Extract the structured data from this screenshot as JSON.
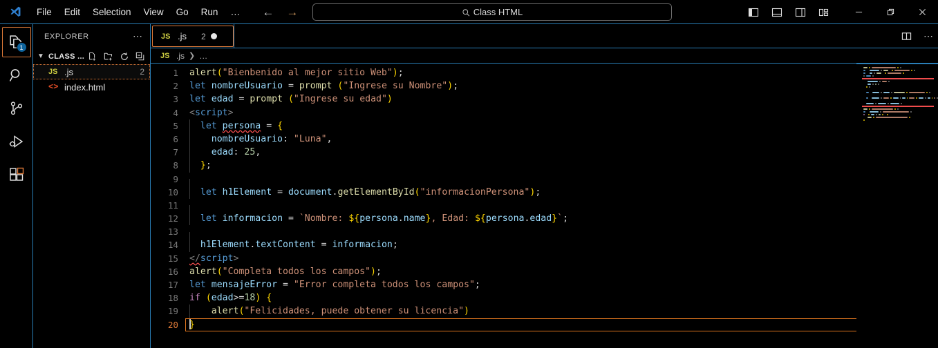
{
  "titlebar": {
    "logo_icon": "vscode-logo-icon",
    "menu": [
      {
        "label": "File"
      },
      {
        "label": "Edit"
      },
      {
        "label": "Selection"
      },
      {
        "label": "View"
      },
      {
        "label": "Go"
      },
      {
        "label": "Run"
      },
      {
        "label": "…"
      }
    ],
    "nav": {
      "back_icon": "arrow-left-icon",
      "forward_icon": "arrow-right-icon"
    },
    "command_center": {
      "icon": "search-icon",
      "text": "Class HTML",
      "placeholder": "Search"
    },
    "layout_actions": [
      {
        "name": "toggle-primary-sidebar",
        "icon": "layout-sidebar-left-icon"
      },
      {
        "name": "toggle-panel",
        "icon": "layout-panel-icon"
      },
      {
        "name": "toggle-secondary-sidebar",
        "icon": "layout-sidebar-right-icon"
      },
      {
        "name": "customize-layout",
        "icon": "layout-customize-icon"
      }
    ],
    "window_controls": [
      {
        "name": "minimize-button",
        "glyph": "─"
      },
      {
        "name": "restore-button",
        "glyph": "❐"
      },
      {
        "name": "close-button",
        "glyph": "✕"
      }
    ]
  },
  "activitybar": {
    "items": [
      {
        "name": "explorer",
        "icon": "files-icon",
        "badge": "1",
        "active": true
      },
      {
        "name": "search",
        "icon": "search-icon",
        "badge": "",
        "active": false
      },
      {
        "name": "source-control",
        "icon": "source-control-icon",
        "badge": "",
        "active": false
      },
      {
        "name": "run-and-debug",
        "icon": "run-debug-icon",
        "badge": "",
        "active": false
      },
      {
        "name": "extensions",
        "icon": "extensions-icon",
        "badge": "",
        "active": false
      }
    ]
  },
  "sidebar": {
    "title": "EXPLORER",
    "more_actions_icon": "ellipsis-icon",
    "folder": {
      "label": "CLASS ...",
      "expanded": true,
      "chevron_icon": "chevron-down-icon",
      "actions": [
        {
          "name": "new-file-button",
          "icon": "new-file-icon"
        },
        {
          "name": "new-folder-button",
          "icon": "new-folder-icon"
        },
        {
          "name": "refresh-explorer-button",
          "icon": "refresh-icon"
        },
        {
          "name": "collapse-folders-button",
          "icon": "collapse-all-icon"
        }
      ]
    },
    "files": [
      {
        "icon": "js-file-icon",
        "icon_label": "JS",
        "name": ".js",
        "count": "2",
        "selected": true
      },
      {
        "icon": "html-file-icon",
        "icon_label": "<>",
        "name": "index.html",
        "count": "",
        "selected": false
      }
    ]
  },
  "editor": {
    "tabs": [
      {
        "icon_label": "JS",
        "label": ".js",
        "count": "2",
        "dirty": true,
        "active": true
      }
    ],
    "tab_actions": [
      {
        "name": "split-editor-right-button",
        "icon": "split-editor-icon"
      },
      {
        "name": "more-editor-actions-button",
        "icon": "ellipsis-icon"
      }
    ],
    "breadcrumbs": [
      {
        "icon_label": "JS",
        "label": ".js"
      },
      {
        "label": "…"
      }
    ],
    "active_line": 20,
    "cursor": {
      "line": 20,
      "column": 1
    },
    "lines": [
      {
        "n": 1,
        "indent": 0,
        "tokens": [
          {
            "t": "alert",
            "c": "c-fn"
          },
          {
            "t": "(",
            "c": "c-paren"
          },
          {
            "t": "\"Bienbenido al mejor sitio Web\"",
            "c": "c-str"
          },
          {
            "t": ")",
            "c": "c-paren"
          },
          {
            "t": ";",
            "c": "c-punc"
          }
        ]
      },
      {
        "n": 2,
        "indent": 0,
        "tokens": [
          {
            "t": "let",
            "c": "c-let"
          },
          {
            "t": " ",
            "c": "c-punc"
          },
          {
            "t": "nombreUsuario",
            "c": "c-var"
          },
          {
            "t": " = ",
            "c": "c-op"
          },
          {
            "t": "prompt",
            "c": "c-fn"
          },
          {
            "t": " ",
            "c": "c-punc"
          },
          {
            "t": "(",
            "c": "c-paren"
          },
          {
            "t": "\"Ingrese su Nombre\"",
            "c": "c-str"
          },
          {
            "t": ")",
            "c": "c-paren"
          },
          {
            "t": ";",
            "c": "c-punc"
          }
        ]
      },
      {
        "n": 3,
        "indent": 0,
        "tokens": [
          {
            "t": "let",
            "c": "c-let"
          },
          {
            "t": " ",
            "c": "c-punc"
          },
          {
            "t": "edad",
            "c": "c-var"
          },
          {
            "t": " = ",
            "c": "c-op"
          },
          {
            "t": "prompt",
            "c": "c-fn"
          },
          {
            "t": " ",
            "c": "c-punc"
          },
          {
            "t": "(",
            "c": "c-paren"
          },
          {
            "t": "\"Ingrese su edad\"",
            "c": "c-str"
          },
          {
            "t": ")",
            "c": "c-paren"
          }
        ]
      },
      {
        "n": 4,
        "indent": 0,
        "tokens": [
          {
            "t": "<",
            "c": "c-tagb"
          },
          {
            "t": "script",
            "c": "c-tag"
          },
          {
            "t": ">",
            "c": "c-tagb"
          }
        ]
      },
      {
        "n": 5,
        "indent": 1,
        "tokens": [
          {
            "t": "  ",
            "c": "c-punc"
          },
          {
            "t": "let",
            "c": "c-let"
          },
          {
            "t": " ",
            "c": "c-punc"
          },
          {
            "t": "persona",
            "c": "c-var squiggly"
          },
          {
            "t": " = ",
            "c": "c-op"
          },
          {
            "t": "{",
            "c": "c-paren"
          }
        ]
      },
      {
        "n": 6,
        "indent": 1,
        "tokens": [
          {
            "t": "    ",
            "c": "c-punc"
          },
          {
            "t": "nombreUsuario",
            "c": "c-prop"
          },
          {
            "t": ": ",
            "c": "c-punc"
          },
          {
            "t": "\"Luna\"",
            "c": "c-str"
          },
          {
            "t": ",",
            "c": "c-punc"
          }
        ]
      },
      {
        "n": 7,
        "indent": 1,
        "tokens": [
          {
            "t": "    ",
            "c": "c-punc"
          },
          {
            "t": "edad",
            "c": "c-prop"
          },
          {
            "t": ": ",
            "c": "c-punc"
          },
          {
            "t": "25",
            "c": "c-num"
          },
          {
            "t": ",",
            "c": "c-punc"
          }
        ]
      },
      {
        "n": 8,
        "indent": 1,
        "tokens": [
          {
            "t": "  ",
            "c": "c-punc"
          },
          {
            "t": "}",
            "c": "c-paren"
          },
          {
            "t": ";",
            "c": "c-punc"
          }
        ]
      },
      {
        "n": 9,
        "indent": 1,
        "tokens": []
      },
      {
        "n": 10,
        "indent": 1,
        "tokens": [
          {
            "t": "  ",
            "c": "c-punc"
          },
          {
            "t": "let",
            "c": "c-let"
          },
          {
            "t": " ",
            "c": "c-punc"
          },
          {
            "t": "h1Element",
            "c": "c-var"
          },
          {
            "t": " = ",
            "c": "c-op"
          },
          {
            "t": "document",
            "c": "c-var"
          },
          {
            "t": ".",
            "c": "c-punc"
          },
          {
            "t": "getElementById",
            "c": "c-fn"
          },
          {
            "t": "(",
            "c": "c-paren"
          },
          {
            "t": "\"informacionPersona\"",
            "c": "c-str"
          },
          {
            "t": ")",
            "c": "c-paren"
          },
          {
            "t": ";",
            "c": "c-punc"
          }
        ]
      },
      {
        "n": 11,
        "indent": 1,
        "tokens": []
      },
      {
        "n": 12,
        "indent": 1,
        "tokens": [
          {
            "t": "  ",
            "c": "c-punc"
          },
          {
            "t": "let",
            "c": "c-let"
          },
          {
            "t": " ",
            "c": "c-punc"
          },
          {
            "t": "informacion",
            "c": "c-var"
          },
          {
            "t": " = ",
            "c": "c-op"
          },
          {
            "t": "`Nombre: ",
            "c": "c-tmpl"
          },
          {
            "t": "${",
            "c": "c-paren"
          },
          {
            "t": "persona",
            "c": "c-var"
          },
          {
            "t": ".",
            "c": "c-punc"
          },
          {
            "t": "name",
            "c": "c-prop"
          },
          {
            "t": "}",
            "c": "c-paren"
          },
          {
            "t": ", Edad: ",
            "c": "c-tmpl"
          },
          {
            "t": "${",
            "c": "c-paren"
          },
          {
            "t": "persona",
            "c": "c-var"
          },
          {
            "t": ".",
            "c": "c-punc"
          },
          {
            "t": "edad",
            "c": "c-prop"
          },
          {
            "t": "}",
            "c": "c-paren"
          },
          {
            "t": "`",
            "c": "c-tmpl"
          },
          {
            "t": ";",
            "c": "c-punc"
          }
        ]
      },
      {
        "n": 13,
        "indent": 1,
        "tokens": []
      },
      {
        "n": 14,
        "indent": 1,
        "tokens": [
          {
            "t": "  ",
            "c": "c-punc"
          },
          {
            "t": "h1Element",
            "c": "c-var"
          },
          {
            "t": ".",
            "c": "c-punc"
          },
          {
            "t": "textContent",
            "c": "c-prop"
          },
          {
            "t": " = ",
            "c": "c-op"
          },
          {
            "t": "informacion",
            "c": "c-var"
          },
          {
            "t": ";",
            "c": "c-punc"
          }
        ]
      },
      {
        "n": 15,
        "indent": 0,
        "tokens": [
          {
            "t": "</",
            "c": "c-tagb squiggly"
          },
          {
            "t": "script",
            "c": "c-tag"
          },
          {
            "t": ">",
            "c": "c-tagb"
          }
        ]
      },
      {
        "n": 16,
        "indent": 0,
        "tokens": [
          {
            "t": "alert",
            "c": "c-fn"
          },
          {
            "t": "(",
            "c": "c-paren"
          },
          {
            "t": "\"Completa todos los campos\"",
            "c": "c-str"
          },
          {
            "t": ")",
            "c": "c-paren"
          },
          {
            "t": ";",
            "c": "c-punc"
          }
        ]
      },
      {
        "n": 17,
        "indent": 0,
        "tokens": [
          {
            "t": "let",
            "c": "c-let"
          },
          {
            "t": " ",
            "c": "c-punc"
          },
          {
            "t": "mensajeError",
            "c": "c-var"
          },
          {
            "t": " = ",
            "c": "c-op"
          },
          {
            "t": "\"Error completa todos los campos\"",
            "c": "c-str"
          },
          {
            "t": ";",
            "c": "c-punc"
          }
        ]
      },
      {
        "n": 18,
        "indent": 0,
        "tokens": [
          {
            "t": "if",
            "c": "c-key"
          },
          {
            "t": " ",
            "c": "c-punc"
          },
          {
            "t": "(",
            "c": "c-paren"
          },
          {
            "t": "edad",
            "c": "c-var"
          },
          {
            "t": ">=",
            "c": "c-op"
          },
          {
            "t": "18",
            "c": "c-num"
          },
          {
            "t": ")",
            "c": "c-paren"
          },
          {
            "t": " ",
            "c": "c-punc"
          },
          {
            "t": "{",
            "c": "c-paren"
          }
        ]
      },
      {
        "n": 19,
        "indent": 1,
        "tokens": [
          {
            "t": "    ",
            "c": "c-punc"
          },
          {
            "t": "alert",
            "c": "c-fn"
          },
          {
            "t": "(",
            "c": "c-paren"
          },
          {
            "t": "\"Felicidades, puede obtener su licencia\"",
            "c": "c-str"
          },
          {
            "t": ")",
            "c": "c-paren"
          }
        ]
      },
      {
        "n": 20,
        "indent": 0,
        "tokens": [
          {
            "t": "}",
            "c": "c-paren"
          }
        ]
      }
    ],
    "minimap": {
      "name": "minimap",
      "error_marker_lines": [
        5,
        15
      ]
    }
  }
}
